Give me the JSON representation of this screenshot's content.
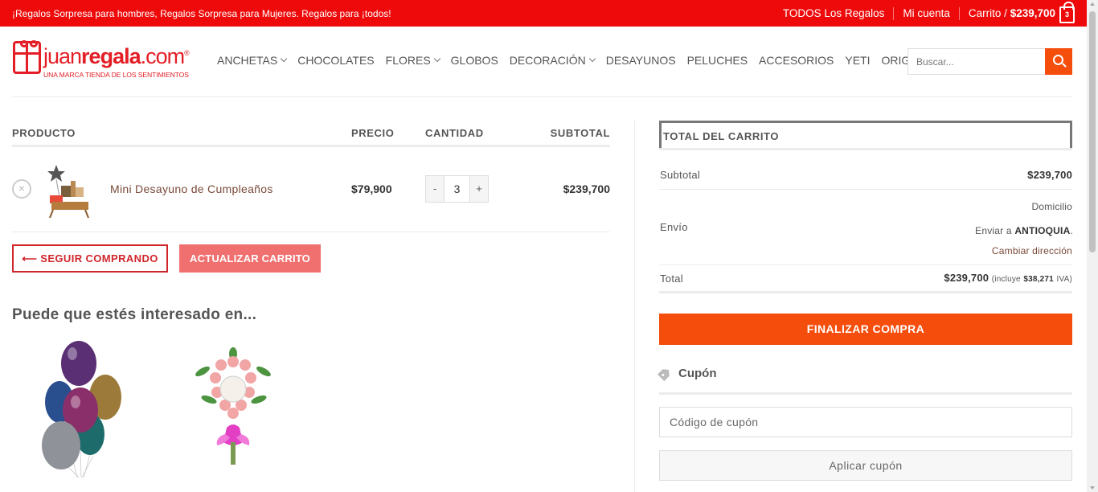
{
  "topbar": {
    "promo": "¡Regalos Sorpresa para hombres, Regalos Sorpresa para Mujeres. Regalos para ¡todos!",
    "all_gifts": "TODOS Los Regalos",
    "account": "Mi cuenta",
    "cart_label": "Carrito /",
    "cart_amount": "$239,700",
    "cart_count": "3"
  },
  "logo": {
    "name_light": "juan",
    "name_bold": "regala",
    "name_tail": ".com",
    "reg": "®",
    "tagline": "UNA MARCA TIENDA DE LOS SENTIMIENTOS"
  },
  "nav": [
    {
      "label": "ANCHETAS",
      "dropdown": true
    },
    {
      "label": "CHOCOLATES",
      "dropdown": false
    },
    {
      "label": "FLORES",
      "dropdown": true
    },
    {
      "label": "GLOBOS",
      "dropdown": false
    },
    {
      "label": "DECORACIÓN",
      "dropdown": true
    },
    {
      "label": "DESAYUNOS",
      "dropdown": false
    },
    {
      "label": "PELUCHES",
      "dropdown": false
    },
    {
      "label": "ACCESORIOS",
      "dropdown": false
    },
    {
      "label": "YETI",
      "dropdown": false
    },
    {
      "label": "ORIGINAL",
      "dropdown": true
    }
  ],
  "search": {
    "placeholder": "Buscar..."
  },
  "cart_table": {
    "headers": {
      "product": "PRODUCTO",
      "price": "PRECIO",
      "quantity": "CANTIDAD",
      "subtotal": "SUBTOTAL"
    },
    "items": [
      {
        "remove": "×",
        "name": "Mini Desayuno de Cumpleaños",
        "price": "$79,900",
        "qty_minus": "-",
        "qty": "3",
        "qty_plus": "+",
        "subtotal": "$239,700"
      }
    ],
    "continue_button": "⟵ SEGUIR COMPRANDO",
    "update_button": "ACTUALIZAR CARRITO"
  },
  "related": {
    "title": "Puede que estés interesado en..."
  },
  "totals": {
    "title": "TOTAL DEL CARRITO",
    "subtotal_label": "Subtotal",
    "subtotal_value": "$239,700",
    "shipping_label": "Envío",
    "shipping_method": "Domicilio",
    "shipping_to_prefix": "Enviar a",
    "shipping_to_region": "ANTIOQUIA",
    "shipping_to_suffix": ".",
    "change_address": "Cambiar dirección",
    "total_label": "Total",
    "total_value": "$239,700",
    "tax_prefix": "(incluye",
    "tax_value": "$38,271",
    "tax_suffix": "IVA)",
    "checkout_button": "FINALIZAR COMPRA"
  },
  "coupon": {
    "title": "Cupón",
    "placeholder": "Código de cupón",
    "apply_button": "Aplicar cupón"
  },
  "colors": {
    "topbar": "#ee0a0a",
    "brand_red": "#e41e26",
    "accent_orange": "#f44d0c",
    "update_button": "#f07070"
  }
}
